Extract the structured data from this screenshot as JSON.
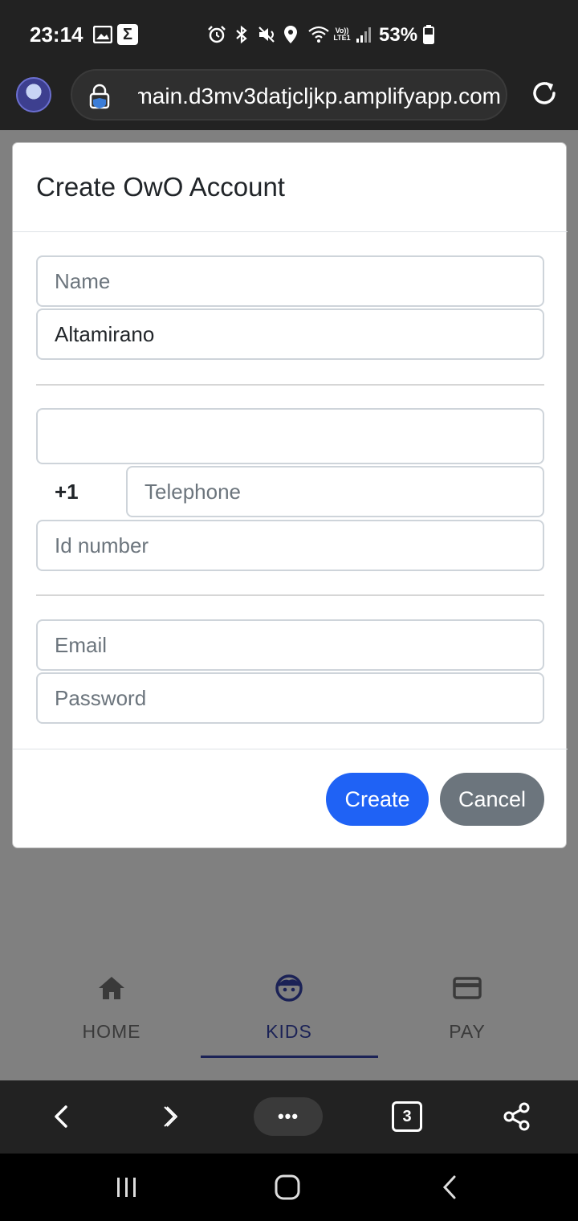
{
  "status_bar": {
    "time": "23:14",
    "lte_top": "Vo))",
    "lte_bottom": "LTE1",
    "battery_percent": "53%"
  },
  "browser": {
    "url": "main.d3mv3datjcljkp.amplifyapp.com",
    "tab_count": "3",
    "more_label": "•••"
  },
  "modal": {
    "title": "Create OwO Account",
    "fields": {
      "name_placeholder": "Name",
      "lastname_value": "Altamirano",
      "blank_value": "",
      "phone_prefix": "+1",
      "telephone_placeholder": "Telephone",
      "id_placeholder": "Id number",
      "email_placeholder": "Email",
      "password_placeholder": "Password"
    },
    "buttons": {
      "create": "Create",
      "cancel": "Cancel"
    }
  },
  "app_nav": {
    "items": [
      {
        "label": "HOME",
        "icon": "home-icon"
      },
      {
        "label": "KIDS",
        "icon": "face-icon",
        "active": true
      },
      {
        "label": "PAY",
        "icon": "credit-card-icon"
      }
    ]
  },
  "colors": {
    "primary": "#1f62f5",
    "secondary": "#6c757d",
    "active_nav": "#1b2256"
  }
}
